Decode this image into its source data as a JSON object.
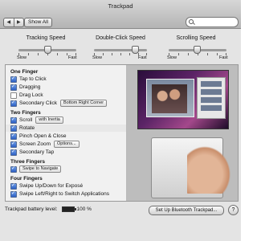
{
  "window": {
    "title": "Trackpad"
  },
  "toolbar": {
    "back_glyph": "◀",
    "forward_glyph": "▶",
    "show_all_label": "Show All",
    "search_placeholder": ""
  },
  "sliders": [
    {
      "title": "Tracking Speed",
      "min_label": "Slow",
      "max_label": "Fast",
      "value": 0.55
    },
    {
      "title": "Double-Click Speed",
      "min_label": "Slow",
      "max_label": "Fast",
      "value": 0.72
    },
    {
      "title": "Scrolling Speed",
      "min_label": "Slow",
      "max_label": "Fast",
      "value": 0.5
    }
  ],
  "settings": {
    "one_finger": {
      "heading": "One Finger",
      "tap_to_click": "Tap to Click",
      "dragging": "Dragging",
      "drag_lock": "Drag Lock",
      "secondary_click": "Secondary Click",
      "secondary_click_option": "Bottom Right Corner"
    },
    "two_fingers": {
      "heading": "Two Fingers",
      "scroll": "Scroll",
      "scroll_option": "with Inertia",
      "rotate": "Rotate",
      "pinch": "Pinch Open & Close",
      "screen_zoom": "Screen Zoom",
      "options_label": "Options...",
      "secondary_tap": "Secondary Tap"
    },
    "three_fingers": {
      "heading": "Three Fingers",
      "swipe": "Swipe to Navigate"
    },
    "four_fingers": {
      "heading": "Four Fingers",
      "expose": "Swipe Up/Down for Exposé",
      "switch_apps": "Swipe Left/Right to Switch Applications"
    }
  },
  "footer": {
    "battery_label": "Trackpad battery level:",
    "battery_value": "100 %",
    "setup_label": "Set Up Bluetooth Trackpad...",
    "help_label": "?"
  }
}
